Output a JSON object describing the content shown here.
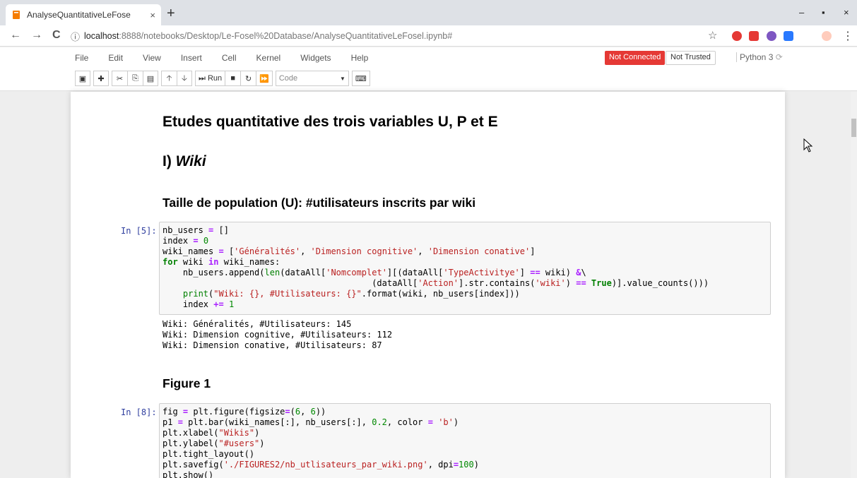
{
  "browser": {
    "tab_title": "AnalyseQuantitativeLeFose",
    "tab_close": "×",
    "new_tab": "+",
    "url_host": "localhost",
    "url_rest": ":8888/notebooks/Desktop/Le-Fosel%20Database/AnalyseQuantitativeLeFosel.ipynb#",
    "info_glyph": "ⓘ",
    "star_glyph": "☆",
    "kebab_glyph": "⋮",
    "minimize_glyph": "–",
    "maximize_glyph": "▪",
    "close_glyph": "×",
    "back_glyph": "←",
    "forward_glyph": "→",
    "reload_glyph": "C"
  },
  "menu": [
    "File",
    "Edit",
    "View",
    "Insert",
    "Cell",
    "Kernel",
    "Widgets",
    "Help"
  ],
  "status": {
    "connection": "Not Connected",
    "trust": "Not Trusted",
    "kernel": "Python 3"
  },
  "toolbar": {
    "run_label": "Run",
    "cell_type": "Code"
  },
  "notebook": {
    "h1": "Etudes quantitative des trois variables U, P et E",
    "h2_prefix": "I) ",
    "h2_em": "Wiki",
    "h3_population": "Taille de population (U): #utilisateurs inscrits par wiki",
    "prompt_1": "In [5]:",
    "output_1": [
      "Wiki: Généralités, #Utilisateurs: 145",
      "Wiki: Dimension cognitive, #Utilisateurs: 112",
      "Wiki: Dimension conative, #Utilisateurs: 87"
    ],
    "h3_figure": "Figure 1",
    "prompt_2": "In [8]:"
  },
  "colors": {
    "not_connected_bg": "#e53935",
    "prompt": "#303f9f",
    "string": "#ba2121",
    "keyword": "#008000",
    "operator": "#aa22ff"
  }
}
